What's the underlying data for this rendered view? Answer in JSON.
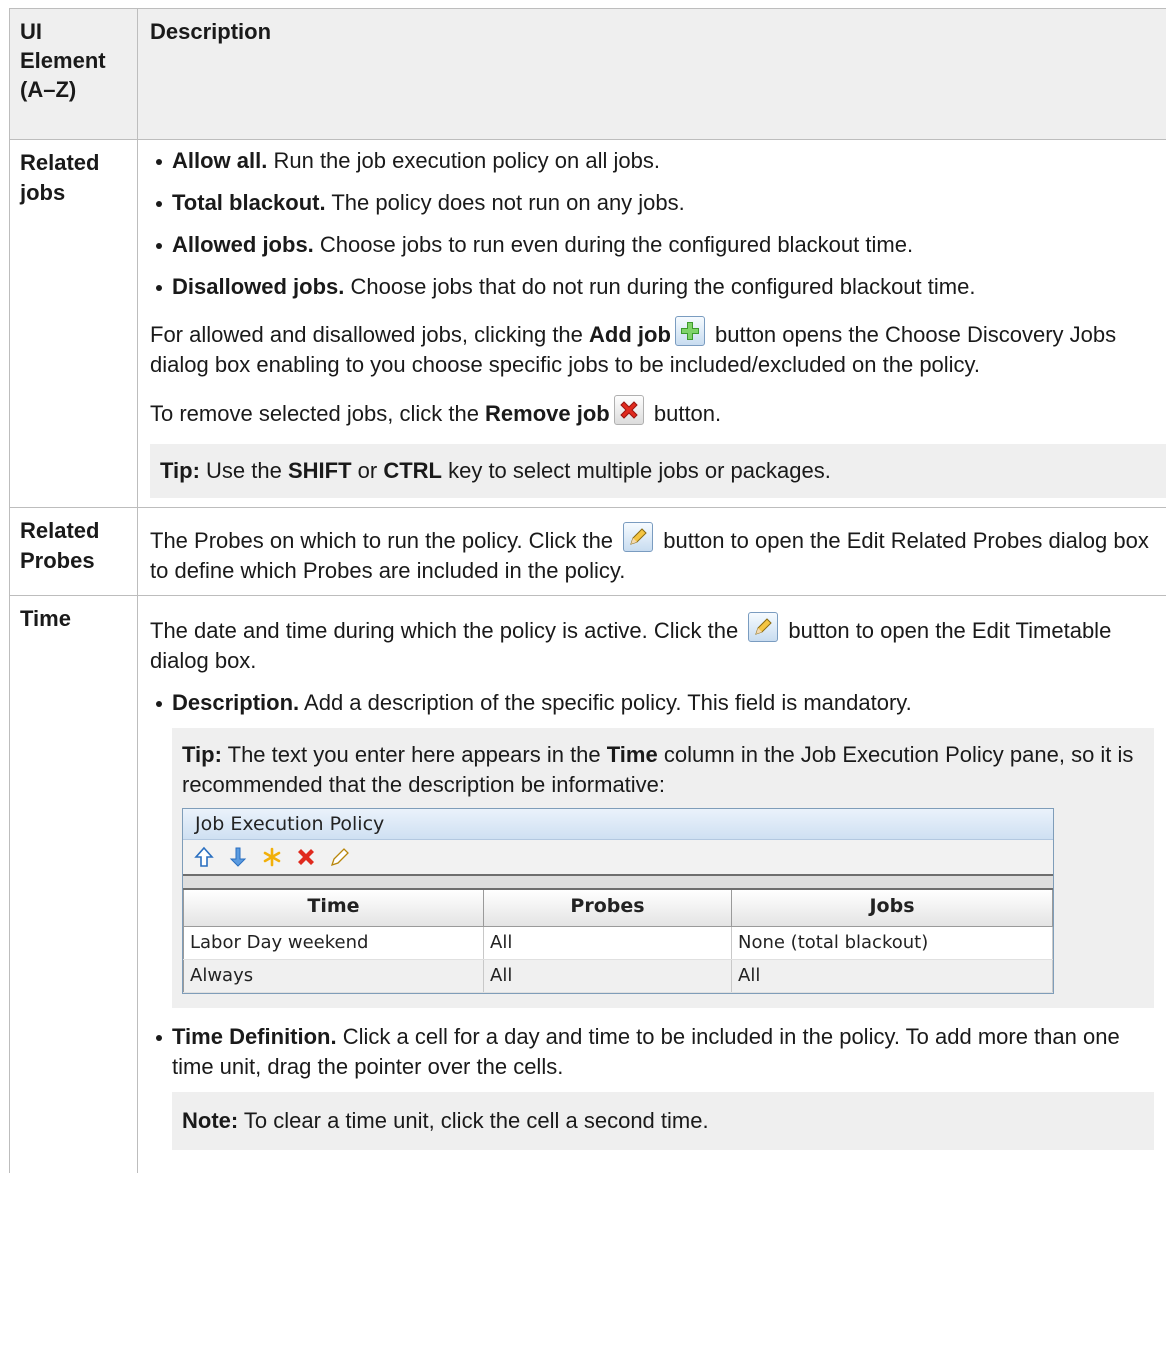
{
  "header": {
    "col_ui": "UI Element (A–Z)",
    "col_desc": "Description"
  },
  "rows": {
    "related_jobs": {
      "name": "Related jobs",
      "bullets": [
        {
          "term": "Allow all.",
          "text": " Run the job execution policy on all jobs."
        },
        {
          "term": "Total blackout.",
          "text": " The policy does not run on any jobs."
        },
        {
          "term": "Allowed jobs.",
          "text": " Choose jobs to run even during the configured blackout time."
        },
        {
          "term": "Disallowed jobs.",
          "text": " Choose jobs that do not run during the configured blackout time."
        }
      ],
      "p1_before": "For allowed and disallowed jobs, clicking the ",
      "p1_bold": "Add job",
      "p1_after": " button opens the Choose Discovery Jobs dialog box enabling to you choose specific jobs to be included/excluded on the policy.",
      "p2_before": "To remove selected jobs, click the ",
      "p2_bold": "Remove job",
      "p2_after": " button.",
      "tip_label": "Tip:",
      "tip_t1": " Use the ",
      "tip_b1": "SHIFT",
      "tip_t2": " or ",
      "tip_b2": "CTRL",
      "tip_t3": " key to select multiple jobs or packages."
    },
    "related_probes": {
      "name": "Related Probes",
      "text_before": "The Probes on which to run the policy. Click the ",
      "text_after": " button to open the Edit Related Probes dialog box to define which Probes are included in the policy."
    },
    "time": {
      "name": "Time",
      "text_before": "The date and time during which the policy is active. Click the ",
      "text_after": " button to open the Edit Timetable dialog box.",
      "desc_term": "Description.",
      "desc_text": " Add a description of the specific policy. This field is mandatory.",
      "tip_label": "Tip:",
      "tip_t1": " The text you enter here appears in the ",
      "tip_b1": "Time",
      "tip_t2": " column in the Job Execution Policy pane, so it is recommended that the description be informative:",
      "timedef_term": "Time Definition.",
      "timedef_text": " Click a cell for a day and time to be included in the policy. To add more than one time unit, drag the pointer over the cells.",
      "note_label": "Note:",
      "note_text": " To clear a time unit, click the cell a second time."
    }
  },
  "jep": {
    "title": "Job Execution Policy",
    "toolbar_icons": [
      "arrow-up-icon",
      "arrow-down-icon",
      "asterisk-icon",
      "delete-x-icon",
      "pencil-icon"
    ],
    "columns": [
      "Time",
      "Probes",
      "Jobs"
    ],
    "rows": [
      [
        "Labor Day weekend",
        "All",
        "None (total blackout)"
      ],
      [
        "Always",
        "All",
        "All"
      ]
    ]
  }
}
